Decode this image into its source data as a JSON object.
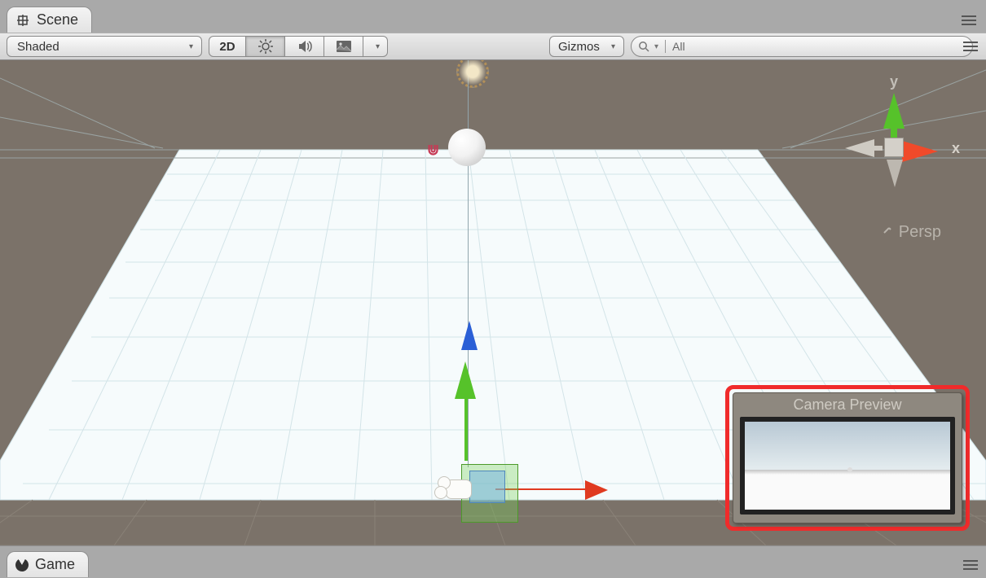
{
  "tabs": {
    "scene": "Scene",
    "game": "Game"
  },
  "toolbar": {
    "draw_mode": "Shaded",
    "btn_2d": "2D",
    "gizmos_label": "Gizmos"
  },
  "search": {
    "placeholder": "All"
  },
  "nav_gizmo": {
    "y": "y",
    "x": "x"
  },
  "view_mode": "Persp",
  "camera_preview": {
    "title": "Camera Preview"
  }
}
